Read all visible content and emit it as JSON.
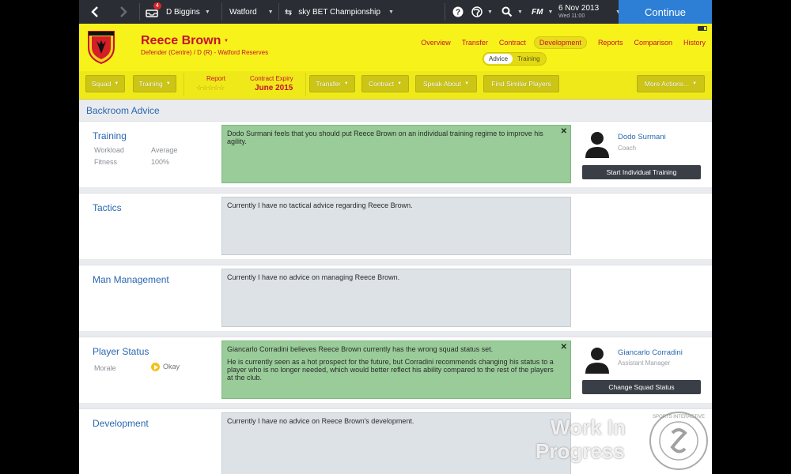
{
  "topbar": {
    "manager": "D Biggins",
    "notification_count": "4",
    "club": "Watford",
    "competition": "sky BET Championship",
    "date": "6 Nov 2013",
    "day_time": "Wed 11:00",
    "fm_label": "FM",
    "continue_label": "Continue"
  },
  "player": {
    "name": "Reece Brown",
    "position_line": "Defender (Centre) / D (R) - Watford Reserves"
  },
  "tabs": [
    "Overview",
    "Transfer",
    "Contract",
    "Development",
    "Reports",
    "Comparison",
    "History"
  ],
  "active_tab": "Development",
  "subtabs": [
    "Advice",
    "Training"
  ],
  "active_subtab": "Advice",
  "toolbar": {
    "squad": "Squad",
    "training": "Training",
    "report_label": "Report",
    "report_stars": "☆☆☆☆☆",
    "contract_expiry_label": "Contract Expiry",
    "contract_expiry_value": "June 2015",
    "transfer": "Transfer",
    "contract": "Contract",
    "speak_about": "Speak About",
    "find_similar": "Find Similar Players",
    "more_actions": "More Actions..."
  },
  "section_title": "Backroom Advice",
  "rows": {
    "training": {
      "title": "Training",
      "workload_label": "Workload",
      "workload_value": "Average",
      "fitness_label": "Fitness",
      "fitness_value": "100%",
      "advice": "Dodo Surmani feels that you should put Reece Brown on an individual training regime to improve his agility.",
      "staff_name": "Dodo Surmani",
      "staff_role": "Coach",
      "action": "Start Individual Training"
    },
    "tactics": {
      "title": "Tactics",
      "advice": "Currently I have no tactical advice regarding Reece Brown."
    },
    "man_management": {
      "title": "Man Management",
      "advice": "Currently I have no advice on managing Reece Brown."
    },
    "player_status": {
      "title": "Player Status",
      "morale_label": "Morale",
      "morale_value": "Okay",
      "advice_p1": "Giancarlo Corradini believes Reece Brown currently has the wrong squad status set.",
      "advice_p2": "He is currently seen as a hot prospect for the future, but Corradini recommends changing his status to a player who is no longer needed, which would better reflect his ability compared to the rest of the players at the club.",
      "staff_name": "Giancarlo Corradini",
      "staff_role": "Assistant Manager",
      "action": "Change Squad Status"
    },
    "development": {
      "title": "Development",
      "advice": "Currently I have no advice on Reece Brown's development."
    }
  },
  "watermark": {
    "line1": "Work In",
    "line2": "Progress",
    "seal_text": "SPORTS INTERACTIVE"
  },
  "colors": {
    "header_yellow": "#f7f31a",
    "club_red": "#c8102e",
    "continue_blue": "#2d7fd6",
    "advice_green": "#99cc99",
    "link_blue": "#2b67b1"
  }
}
